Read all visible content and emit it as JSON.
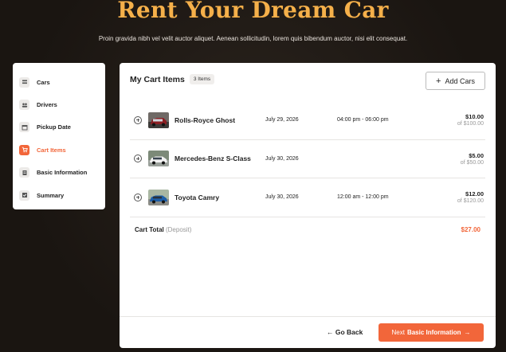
{
  "hero": {
    "title": "Rent Your Dream Car",
    "subtitle": "Proin gravida nibh vel velit auctor aliquet. Aenean sollicitudin, lorem quis bibendum auctor, nisi elit consequat."
  },
  "sidebar": {
    "items": [
      {
        "label": "Cars",
        "icon": "car-list-icon"
      },
      {
        "label": "Drivers",
        "icon": "users-icon"
      },
      {
        "label": "Pickup Date",
        "icon": "calendar-icon"
      },
      {
        "label": "Cart Items",
        "icon": "cart-icon",
        "active": true
      },
      {
        "label": "Basic Information",
        "icon": "document-icon"
      },
      {
        "label": "Summary",
        "icon": "checklist-icon"
      }
    ]
  },
  "cart": {
    "title": "My Cart Items",
    "count_badge": "3 Items",
    "add_button": "Add Cars",
    "items": [
      {
        "name": "Rolls-Royce Ghost",
        "date": "July 29, 2026",
        "time": "04:00 pm - 06:00 pm",
        "price": "$10.00",
        "of": "of $100.00"
      },
      {
        "name": "Mercedes-Benz S-Class",
        "date": "July 30, 2026",
        "time": "",
        "price": "$5.00",
        "of": "of $50.00"
      },
      {
        "name": "Toyota Camry",
        "date": "July 30, 2026",
        "time": "12:00 am - 12:00 pm",
        "price": "$12.00",
        "of": "of $120.00"
      }
    ],
    "total_label": "Cart Total",
    "total_note": "(Deposit)",
    "total_value": "$27.00"
  },
  "footer": {
    "back": "← Go Back",
    "next_prefix": "Next",
    "next_strong": "Basic Information",
    "next_arrow": "→"
  },
  "colors": {
    "accent": "#f2663a",
    "title_gold": "#f5b04a",
    "background": "#1f1a16"
  }
}
